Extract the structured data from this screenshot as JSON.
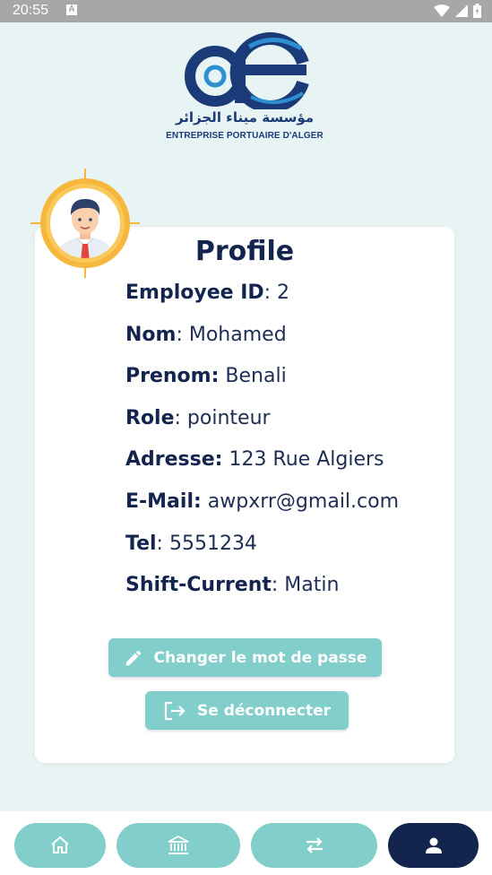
{
  "status_bar": {
    "time": "20:55",
    "notification_icon": "A"
  },
  "logo": {
    "arabic_text": "مؤسسة ميناء الجزائر",
    "latin_text": "ENTREPRISE PORTUAIRE D'ALGER",
    "brand_color": "#1b3b78"
  },
  "profile": {
    "title": "Profile",
    "fields": [
      {
        "label": "Employee ID",
        "value": ": 2"
      },
      {
        "label": "Nom",
        "value": ": Mohamed"
      },
      {
        "label": "Prenom:",
        "value": " Benali"
      },
      {
        "label": "Role",
        "value": ": pointeur"
      },
      {
        "label": "Adresse:",
        "value": " 123 Rue Algiers"
      },
      {
        "label": "E-Mail:",
        "value": " awpxrr@gmail.com"
      },
      {
        "label": "Tel",
        "value": ": 5551234"
      },
      {
        "label": "Shift-Current",
        "value": ": Matin"
      }
    ]
  },
  "actions": {
    "change_password": "Changer le mot de passe",
    "logout": "Se déconnecter"
  },
  "bottom_nav": [
    {
      "icon": "home-icon",
      "active": false
    },
    {
      "icon": "bank-icon",
      "active": false
    },
    {
      "icon": "swap-arrows-icon",
      "active": false
    },
    {
      "icon": "person-icon",
      "active": true
    }
  ],
  "colors": {
    "background": "#e8f3f3",
    "accent": "#81cecb",
    "primary_dark": "#13254f",
    "avatar_ring": "#f6b73c"
  }
}
